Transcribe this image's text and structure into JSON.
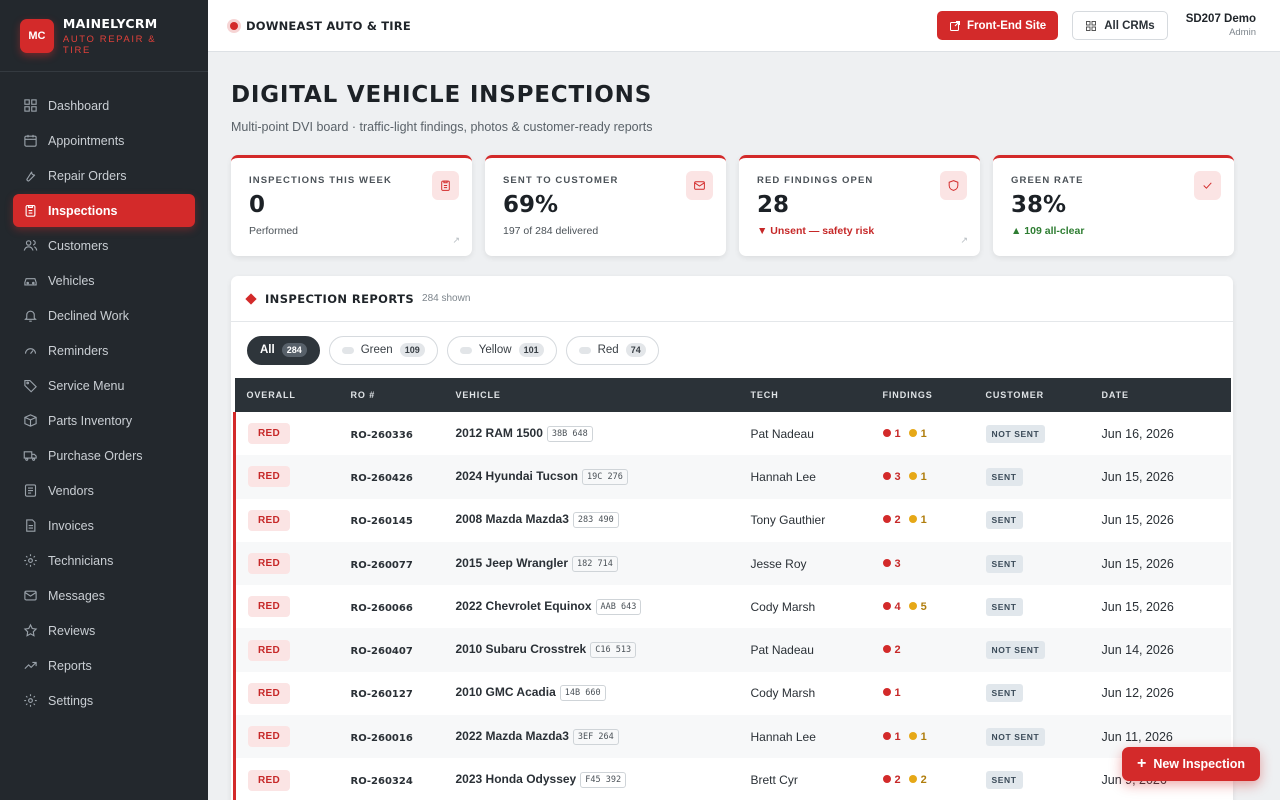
{
  "brand": {
    "logo": "MC",
    "name": "MAINELYCRM",
    "sub": "AUTO REPAIR & TIRE"
  },
  "nav": [
    {
      "label": "Dashboard",
      "icon": "dashboard-icon"
    },
    {
      "label": "Appointments",
      "icon": "calendar-icon"
    },
    {
      "label": "Repair Orders",
      "icon": "wrench-icon"
    },
    {
      "label": "Inspections",
      "icon": "clipboard-icon",
      "active": true
    },
    {
      "label": "Customers",
      "icon": "users-icon"
    },
    {
      "label": "Vehicles",
      "icon": "car-icon"
    },
    {
      "label": "Declined Work",
      "icon": "bell-icon"
    },
    {
      "label": "Reminders",
      "icon": "gauge-icon"
    },
    {
      "label": "Service Menu",
      "icon": "tag-icon"
    },
    {
      "label": "Parts Inventory",
      "icon": "box-icon"
    },
    {
      "label": "Purchase Orders",
      "icon": "truck-icon"
    },
    {
      "label": "Vendors",
      "icon": "list-icon"
    },
    {
      "label": "Invoices",
      "icon": "document-icon"
    },
    {
      "label": "Technicians",
      "icon": "gear-icon"
    },
    {
      "label": "Messages",
      "icon": "mail-icon"
    },
    {
      "label": "Reviews",
      "icon": "star-icon"
    },
    {
      "label": "Reports",
      "icon": "trend-icon"
    },
    {
      "label": "Settings",
      "icon": "settings-icon"
    }
  ],
  "topbar": {
    "shop_name": "DOWNEAST AUTO & TIRE",
    "front_end_label": "Front-End Site",
    "all_crms_label": "All CRMs",
    "user_name": "SD207 Demo",
    "user_role": "Admin"
  },
  "page": {
    "title": "DIGITAL VEHICLE INSPECTIONS",
    "subtitle": "Multi-point DVI board · traffic-light findings, photos & customer-ready reports"
  },
  "cards": [
    {
      "label": "INSPECTIONS THIS WEEK",
      "value": "0",
      "note": "Performed",
      "note_style": "",
      "icon": "clipboard-icon",
      "corner": "↗"
    },
    {
      "label": "SENT TO CUSTOMER",
      "value": "69%",
      "note": "197 of 284 delivered",
      "note_style": "",
      "icon": "mail-icon",
      "corner": ""
    },
    {
      "label": "RED FINDINGS OPEN",
      "value": "28",
      "note": "▼ Unsent — safety risk",
      "note_style": "red",
      "icon": "shield-icon",
      "corner": "↗"
    },
    {
      "label": "GREEN RATE",
      "value": "38%",
      "note": "▲ 109 all-clear",
      "note_style": "green",
      "icon": "check-icon",
      "corner": ""
    }
  ],
  "reports": {
    "title": "INSPECTION REPORTS",
    "count": "284 shown",
    "filters": [
      {
        "label": "All",
        "count": "284",
        "active": true
      },
      {
        "label": "Green",
        "count": "109"
      },
      {
        "label": "Yellow",
        "count": "101"
      },
      {
        "label": "Red",
        "count": "74"
      }
    ],
    "columns": [
      "OVERALL",
      "RO #",
      "VEHICLE",
      "TECH",
      "FINDINGS",
      "CUSTOMER",
      "DATE"
    ],
    "rows": [
      {
        "overall": "RED",
        "ro": "RO-260336",
        "vehicle": "2012 RAM 1500",
        "plate": "38B 648",
        "tech": "Pat Nadeau",
        "red": "1",
        "yellow": "1",
        "customer": "NOT SENT",
        "date": "Jun 16, 2026"
      },
      {
        "overall": "RED",
        "ro": "RO-260426",
        "vehicle": "2024 Hyundai Tucson",
        "plate": "19C 276",
        "tech": "Hannah Lee",
        "red": "3",
        "yellow": "1",
        "customer": "SENT",
        "date": "Jun 15, 2026"
      },
      {
        "overall": "RED",
        "ro": "RO-260145",
        "vehicle": "2008 Mazda Mazda3",
        "plate": "283 490",
        "tech": "Tony Gauthier",
        "red": "2",
        "yellow": "1",
        "customer": "SENT",
        "date": "Jun 15, 2026"
      },
      {
        "overall": "RED",
        "ro": "RO-260077",
        "vehicle": "2015 Jeep Wrangler",
        "plate": "182 714",
        "tech": "Jesse Roy",
        "red": "3",
        "yellow": "",
        "customer": "SENT",
        "date": "Jun 15, 2026"
      },
      {
        "overall": "RED",
        "ro": "RO-260066",
        "vehicle": "2022 Chevrolet Equinox",
        "plate": "AAB 643",
        "tech": "Cody Marsh",
        "red": "4",
        "yellow": "5",
        "customer": "SENT",
        "date": "Jun 15, 2026"
      },
      {
        "overall": "RED",
        "ro": "RO-260407",
        "vehicle": "2010 Subaru Crosstrek",
        "plate": "C16 513",
        "tech": "Pat Nadeau",
        "red": "2",
        "yellow": "",
        "customer": "NOT SENT",
        "date": "Jun 14, 2026"
      },
      {
        "overall": "RED",
        "ro": "RO-260127",
        "vehicle": "2010 GMC Acadia",
        "plate": "14B 660",
        "tech": "Cody Marsh",
        "red": "1",
        "yellow": "",
        "customer": "SENT",
        "date": "Jun 12, 2026"
      },
      {
        "overall": "RED",
        "ro": "RO-260016",
        "vehicle": "2022 Mazda Mazda3",
        "plate": "3EF 264",
        "tech": "Hannah Lee",
        "red": "1",
        "yellow": "1",
        "customer": "NOT SENT",
        "date": "Jun 11, 2026"
      },
      {
        "overall": "RED",
        "ro": "RO-260324",
        "vehicle": "2023 Honda Odyssey",
        "plate": "F45 392",
        "tech": "Brett Cyr",
        "red": "2",
        "yellow": "2",
        "customer": "SENT",
        "date": "Jun 9, 2026"
      }
    ]
  },
  "fab_label": "New Inspection",
  "colors": {
    "accent": "#d32a2a",
    "sidebar": "#23282d",
    "yellow": "#e6a817"
  }
}
